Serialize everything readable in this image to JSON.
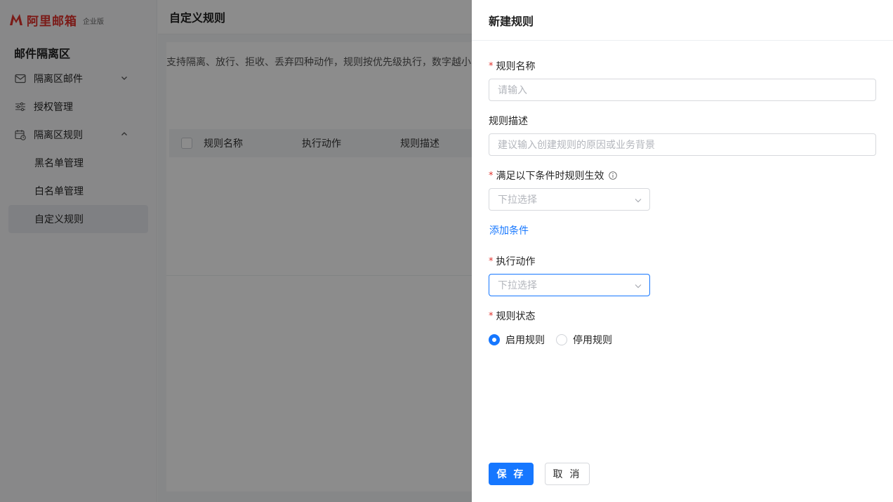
{
  "app": {
    "logo_text": "阿里邮箱",
    "logo_badge": "企业版",
    "brand_color": "#e0322d",
    "accent_color": "#1677ff"
  },
  "sidebar": {
    "section_title": "邮件隔离区",
    "items": [
      {
        "label": "隔离区邮件",
        "icon": "mail-icon",
        "expanded": false
      },
      {
        "label": "授权管理",
        "icon": "sliders-icon"
      },
      {
        "label": "隔离区规则",
        "icon": "calendar-clock-icon",
        "expanded": true,
        "children": [
          {
            "label": "黑名单管理",
            "active": false
          },
          {
            "label": "白名单管理",
            "active": false
          },
          {
            "label": "自定义规则",
            "active": true
          }
        ]
      }
    ]
  },
  "main": {
    "title": "自定义规则",
    "description": "支持隔离、放行、拒收、丢弃四种动作，规则按优先级执行，数字越小",
    "table_headers": [
      "规则名称",
      "执行动作",
      "规则描述"
    ]
  },
  "drawer": {
    "title": "新建规则",
    "fields": {
      "rule_name": {
        "label": "规则名称",
        "placeholder": "请输入",
        "required": true
      },
      "rule_desc": {
        "label": "规则描述",
        "placeholder": "建议输入创建规则的原因或业务背景",
        "required": false
      },
      "condition": {
        "label": "满足以下条件时规则生效",
        "placeholder": "下拉选择",
        "required": true
      },
      "add_condition": "添加条件",
      "action": {
        "label": "执行动作",
        "placeholder": "下拉选择",
        "required": true
      },
      "status": {
        "label": "规则状态",
        "required": true,
        "options": [
          {
            "label": "启用规则",
            "checked": true
          },
          {
            "label": "停用规则",
            "checked": false
          }
        ]
      }
    },
    "buttons": {
      "save": "保 存",
      "cancel": "取 消"
    }
  }
}
